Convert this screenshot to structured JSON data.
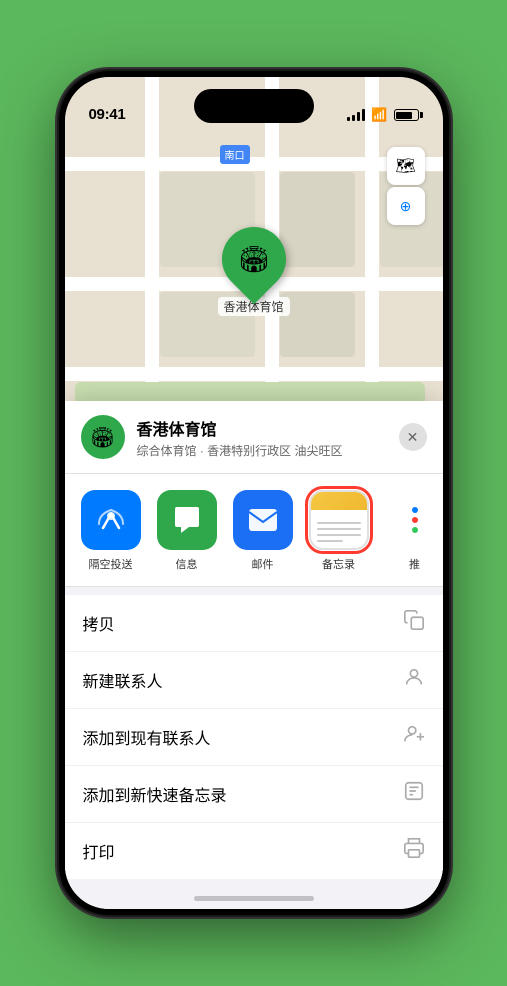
{
  "statusBar": {
    "time": "09:41",
    "locationArrow": "▲"
  },
  "mapLabel": {
    "text": "南口"
  },
  "mapControls": {
    "mapViewIcon": "🗺",
    "locationIcon": "⬆"
  },
  "venuePin": {
    "emoji": "🏟",
    "label": "香港体育馆"
  },
  "venueCard": {
    "icon": "🏟",
    "name": "香港体育馆",
    "desc": "综合体育馆 · 香港特别行政区 油尖旺区",
    "closeLabel": "✕"
  },
  "shareItems": [
    {
      "id": "airdrop",
      "type": "airdrop",
      "label": "隔空投送"
    },
    {
      "id": "message",
      "type": "message",
      "label": "信息"
    },
    {
      "id": "mail",
      "type": "mail",
      "label": "邮件"
    },
    {
      "id": "notes",
      "type": "notes",
      "label": "备忘录",
      "selected": true
    },
    {
      "id": "more",
      "type": "more",
      "label": "推"
    }
  ],
  "actionItems": [
    {
      "id": "copy",
      "label": "拷贝",
      "icon": "⧉"
    },
    {
      "id": "contact",
      "label": "新建联系人",
      "icon": "👤"
    },
    {
      "id": "addexist",
      "label": "添加到现有联系人",
      "icon": "👤"
    },
    {
      "id": "quicknote",
      "label": "添加到新快速备忘录",
      "icon": "🗒"
    },
    {
      "id": "print",
      "label": "打印",
      "icon": "🖨"
    }
  ]
}
